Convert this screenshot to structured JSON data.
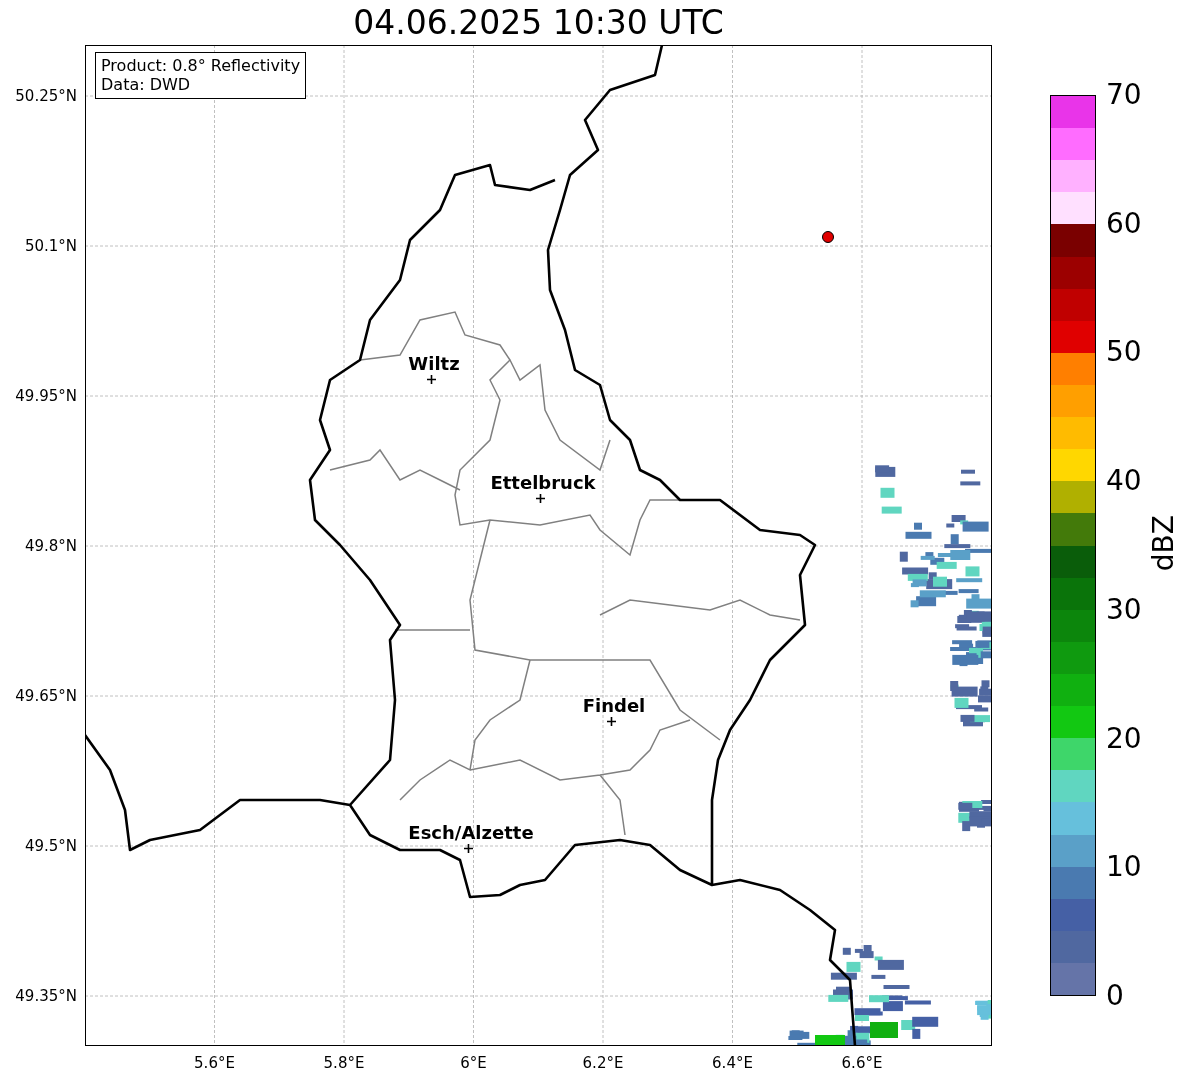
{
  "title": "04.06.2025 10:30 UTC",
  "info_box": [
    "Product: 0.8° Reflectivity",
    "Data: DWD"
  ],
  "lat_ticks": [
    "50.25°N",
    "50.1°N",
    "49.95°N",
    "49.8°N",
    "49.65°N",
    "49.5°N",
    "49.35°N"
  ],
  "lon_ticks": [
    "5.6°E",
    "5.8°E",
    "6°E",
    "6.2°E",
    "6.4°E",
    "6.6°E"
  ],
  "cities": [
    {
      "name": "Wiltz"
    },
    {
      "name": "Ettelbruck"
    },
    {
      "name": "Findel"
    },
    {
      "name": "Esch/Alzette"
    }
  ],
  "colorbar": {
    "label": "dBZ",
    "ticks": [
      "70",
      "60",
      "50",
      "40",
      "30",
      "20",
      "10",
      "0"
    ],
    "segments": [
      {
        "color": "#e934e9"
      },
      {
        "color": "#ff6cff"
      },
      {
        "color": "#ffb1ff"
      },
      {
        "color": "#ffe0ff"
      },
      {
        "color": "#7a0000"
      },
      {
        "color": "#9c0000"
      },
      {
        "color": "#c00000"
      },
      {
        "color": "#e00000"
      },
      {
        "color": "#ff7f00"
      },
      {
        "color": "#ff9f00"
      },
      {
        "color": "#ffbb00"
      },
      {
        "color": "#ffd700"
      },
      {
        "color": "#b0b000"
      },
      {
        "color": "#437a0a"
      },
      {
        "color": "#0a5d0a"
      },
      {
        "color": "#0a740a"
      },
      {
        "color": "#0c860c"
      },
      {
        "color": "#0f9a0f"
      },
      {
        "color": "#10b010"
      },
      {
        "color": "#12c812"
      },
      {
        "color": "#3ed66a"
      },
      {
        "color": "#60d6c0"
      },
      {
        "color": "#66c0dc"
      },
      {
        "color": "#5aa0c8"
      },
      {
        "color": "#4a7ab0"
      },
      {
        "color": "#4560a5"
      },
      {
        "color": "#5068a0"
      },
      {
        "color": "#6574a8"
      }
    ]
  }
}
